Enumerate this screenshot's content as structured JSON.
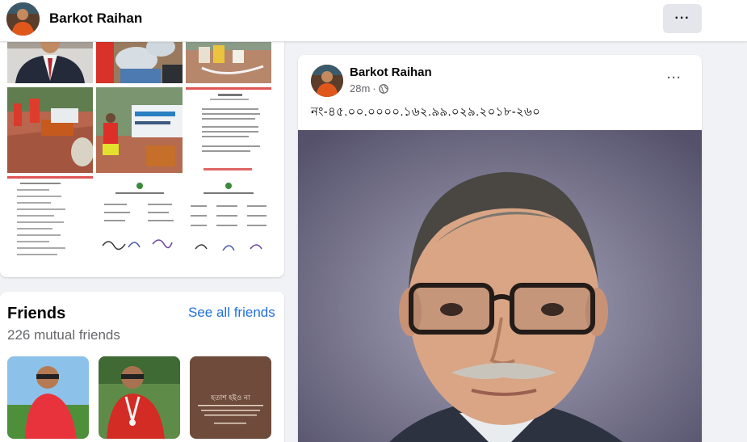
{
  "profile": {
    "name": "Barkot Raihan",
    "more_label": "···"
  },
  "photos": {
    "items": [
      {
        "name": "photo-man-portrait"
      },
      {
        "name": "photo-relief-goods"
      },
      {
        "name": "photo-water-pump"
      },
      {
        "name": "photo-pump-installation"
      },
      {
        "name": "photo-banner-volunteer"
      },
      {
        "name": "photo-document-letter"
      },
      {
        "name": "photo-document-list"
      },
      {
        "name": "photo-document-signatures"
      },
      {
        "name": "photo-document-table"
      }
    ]
  },
  "friends": {
    "title": "Friends",
    "see_all": "See all friends",
    "mutual": "226 mutual friends",
    "items": [
      {
        "name": "friend-photo-1"
      },
      {
        "name": "friend-photo-2"
      },
      {
        "name": "friend-photo-3",
        "quote_title": "হতাশ হইও না"
      }
    ]
  },
  "post": {
    "author": "Barkot Raihan",
    "time": "28m",
    "separator": "·",
    "audience_icon": "globe-icon",
    "more_label": "···",
    "text": "নং-৪৫.০০.০০০০.১৬২.৯৯.০২৯.২০১৮-২৬০"
  },
  "colors": {
    "accent_link": "#216fdb",
    "secondary_text": "#65676b",
    "page_bg": "#f0f2f5"
  }
}
